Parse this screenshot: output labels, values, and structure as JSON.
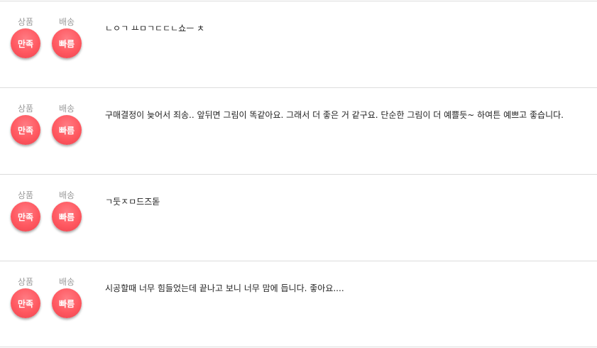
{
  "reviews": [
    {
      "product_label": "상품",
      "product_rating": "만족",
      "delivery_label": "배송",
      "delivery_rating": "빠름",
      "text": "ㄴㅇㄱ ㅛㅁㄱㄷㄷㄴ쇼ㅡ ㅊ"
    },
    {
      "product_label": "상품",
      "product_rating": "만족",
      "delivery_label": "배송",
      "delivery_rating": "빠름",
      "text": "구매결정이 늦어서 죄송.. 앞뒤면 그림이 똑같아요. 그래서 더 좋은 거 같구요. 단순한 그림이 더 예쁠듯~ 하여튼 예쁘고 좋습니다."
    },
    {
      "product_label": "상품",
      "product_rating": "만족",
      "delivery_label": "배송",
      "delivery_rating": "빠름",
      "text": "ㄱ둣ㅈㅁ드즈돋"
    },
    {
      "product_label": "상품",
      "product_rating": "만족",
      "delivery_label": "배송",
      "delivery_rating": "빠름",
      "text": "시공할때 너무 힘들었는데 끝나고 보니 너무 맘에 듭니다. 좋아요...."
    }
  ],
  "colors": {
    "badge": "#ff5860",
    "label": "#9a9a9a",
    "divider": "#dcdcdc"
  }
}
